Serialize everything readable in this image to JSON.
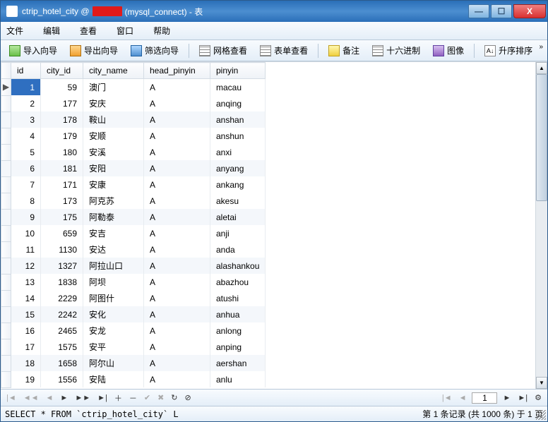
{
  "window": {
    "title_prefix": "ctrip_hotel_city @",
    "title_suffix": " (mysql_connect) - 表"
  },
  "menu": {
    "file": "文件",
    "edit": "编辑",
    "view": "查看",
    "window": "窗口",
    "help": "帮助"
  },
  "toolbar": {
    "import": "导入向导",
    "export": "导出向导",
    "filter": "筛选向导",
    "gridview": "网格查看",
    "formview": "表单查看",
    "memo": "备注",
    "hex": "十六进制",
    "image": "图像",
    "sort": "升序排序"
  },
  "columns": {
    "id": "id",
    "city_id": "city_id",
    "city_name": "city_name",
    "head_pinyin": "head_pinyin",
    "pinyin": "pinyin"
  },
  "rows": [
    {
      "id": "1",
      "city_id": "59",
      "city_name": "澳门",
      "head_pinyin": "A",
      "pinyin": "macau"
    },
    {
      "id": "2",
      "city_id": "177",
      "city_name": "安庆",
      "head_pinyin": "A",
      "pinyin": "anqing"
    },
    {
      "id": "3",
      "city_id": "178",
      "city_name": "鞍山",
      "head_pinyin": "A",
      "pinyin": "anshan"
    },
    {
      "id": "4",
      "city_id": "179",
      "city_name": "安顺",
      "head_pinyin": "A",
      "pinyin": "anshun"
    },
    {
      "id": "5",
      "city_id": "180",
      "city_name": "安溪",
      "head_pinyin": "A",
      "pinyin": "anxi"
    },
    {
      "id": "6",
      "city_id": "181",
      "city_name": "安阳",
      "head_pinyin": "A",
      "pinyin": "anyang"
    },
    {
      "id": "7",
      "city_id": "171",
      "city_name": "安康",
      "head_pinyin": "A",
      "pinyin": "ankang"
    },
    {
      "id": "8",
      "city_id": "173",
      "city_name": "阿克苏",
      "head_pinyin": "A",
      "pinyin": "akesu"
    },
    {
      "id": "9",
      "city_id": "175",
      "city_name": "阿勒泰",
      "head_pinyin": "A",
      "pinyin": "aletai"
    },
    {
      "id": "10",
      "city_id": "659",
      "city_name": "安吉",
      "head_pinyin": "A",
      "pinyin": "anji"
    },
    {
      "id": "11",
      "city_id": "1130",
      "city_name": "安达",
      "head_pinyin": "A",
      "pinyin": "anda"
    },
    {
      "id": "12",
      "city_id": "1327",
      "city_name": "阿拉山口",
      "head_pinyin": "A",
      "pinyin": "alashankou"
    },
    {
      "id": "13",
      "city_id": "1838",
      "city_name": "阿坝",
      "head_pinyin": "A",
      "pinyin": "abazhou"
    },
    {
      "id": "14",
      "city_id": "2229",
      "city_name": "阿图什",
      "head_pinyin": "A",
      "pinyin": "atushi"
    },
    {
      "id": "15",
      "city_id": "2242",
      "city_name": "安化",
      "head_pinyin": "A",
      "pinyin": "anhua"
    },
    {
      "id": "16",
      "city_id": "2465",
      "city_name": "安龙",
      "head_pinyin": "A",
      "pinyin": "anlong"
    },
    {
      "id": "17",
      "city_id": "1575",
      "city_name": "安平",
      "head_pinyin": "A",
      "pinyin": "anping"
    },
    {
      "id": "18",
      "city_id": "1658",
      "city_name": "阿尔山",
      "head_pinyin": "A",
      "pinyin": "aershan"
    },
    {
      "id": "19",
      "city_id": "1556",
      "city_name": "安陆",
      "head_pinyin": "A",
      "pinyin": "anlu"
    }
  ],
  "nav": {
    "page": "1"
  },
  "status": {
    "query": "SELECT * FROM `ctrip_hotel_city` L",
    "info": "第 1 条记录 (共 1000 条) 于 1 页"
  }
}
